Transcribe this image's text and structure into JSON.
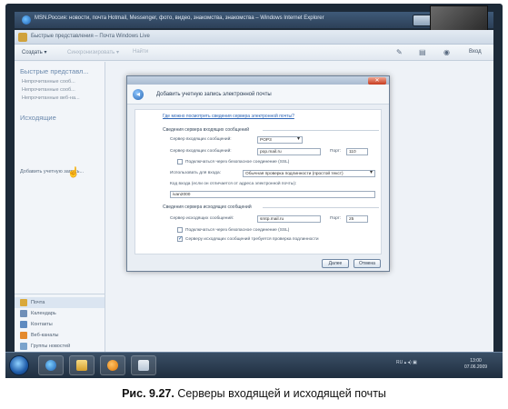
{
  "ie": {
    "title": "MSN.Россия: новости, почта Hotmail, Messenger, фото, видео, знакомства, знакомства – Windows Internet Explorer"
  },
  "mail": {
    "title": "Быстрые представления – Почта Windows Live",
    "toolbar": {
      "create": "Создать ▾",
      "sync": "Синхронизировать ▾",
      "find": "Найти",
      "signin": "Вход"
    }
  },
  "sidebar": {
    "quick_views": "Быстрые представл...",
    "quick_items": [
      "Непрочитанные сооб...",
      "Непрочитанные сооб...",
      "Непрочитанные веб-на..."
    ],
    "outbox": "Исходящие",
    "add_account": "Добавить учетную запись...",
    "modules": [
      "Почта",
      "Календарь",
      "Контакты",
      "Веб-каналы",
      "Группы новостей"
    ]
  },
  "dialog": {
    "title": "Добавить учетную запись электронной почты",
    "close": "✕",
    "help_link": "Где можно посмотреть сведения сервера электронной почты?",
    "incoming_section": "Сведения сервера входящих сообщений",
    "server_type_label": "Сервер входящих сообщений:",
    "server_type_value": "POP3",
    "incoming_server_label": "Сервер входящих сообщений:",
    "incoming_server_value": "pop.mail.ru",
    "port_label": "Порт:",
    "incoming_port": "110",
    "ssl_incoming": "Подключаться через безопасное соединение (SSL)",
    "auth_label": "Использовать для входа:",
    "auth_value": "Обычная проверка подлинности (простой текст)",
    "login_label": "Код входа (если он отличается от адреса электронной почты):",
    "login_value": "ivan2000",
    "outgoing_section": "Сведения сервера исходящих сообщений",
    "outgoing_server_label": "Сервер исходящих сообщений:",
    "outgoing_server_value": "smtp.mail.ru",
    "outgoing_port": "25",
    "ssl_outgoing": "Подключаться через безопасное соединение (SSL)",
    "auth_required": "Серверу исходящих сообщений требуется проверка подлинности",
    "next": "Далее",
    "cancel": "Отмена"
  },
  "taskbar": {
    "tray": "RU  ▴  ◂)  ▣",
    "time": "13:00",
    "date": "07.06.2009"
  },
  "caption": {
    "label": "Рис. 9.27.",
    "text": "Серверы входящей и исходящей почты"
  },
  "colors": {
    "accent": "#2c64b5",
    "frame": "#1d2a38",
    "taskbar": "#2a3d52"
  }
}
